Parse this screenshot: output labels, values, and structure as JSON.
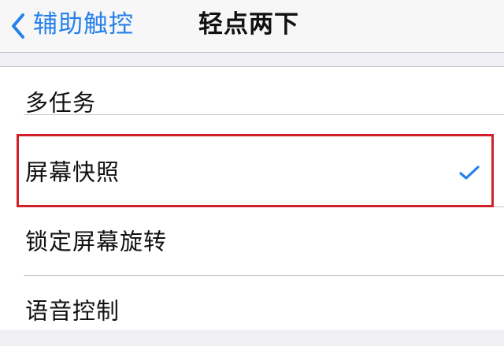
{
  "navbar": {
    "back_label": "辅助触控",
    "title": "轻点两下"
  },
  "list": {
    "items": [
      {
        "label": "多任务",
        "selected": false
      },
      {
        "label": "屏幕快照",
        "selected": true
      },
      {
        "label": "锁定屏幕旋转",
        "selected": false
      },
      {
        "label": "语音控制",
        "selected": false
      }
    ]
  },
  "colors": {
    "accent": "#2680eb",
    "highlight": "#d0202a"
  }
}
